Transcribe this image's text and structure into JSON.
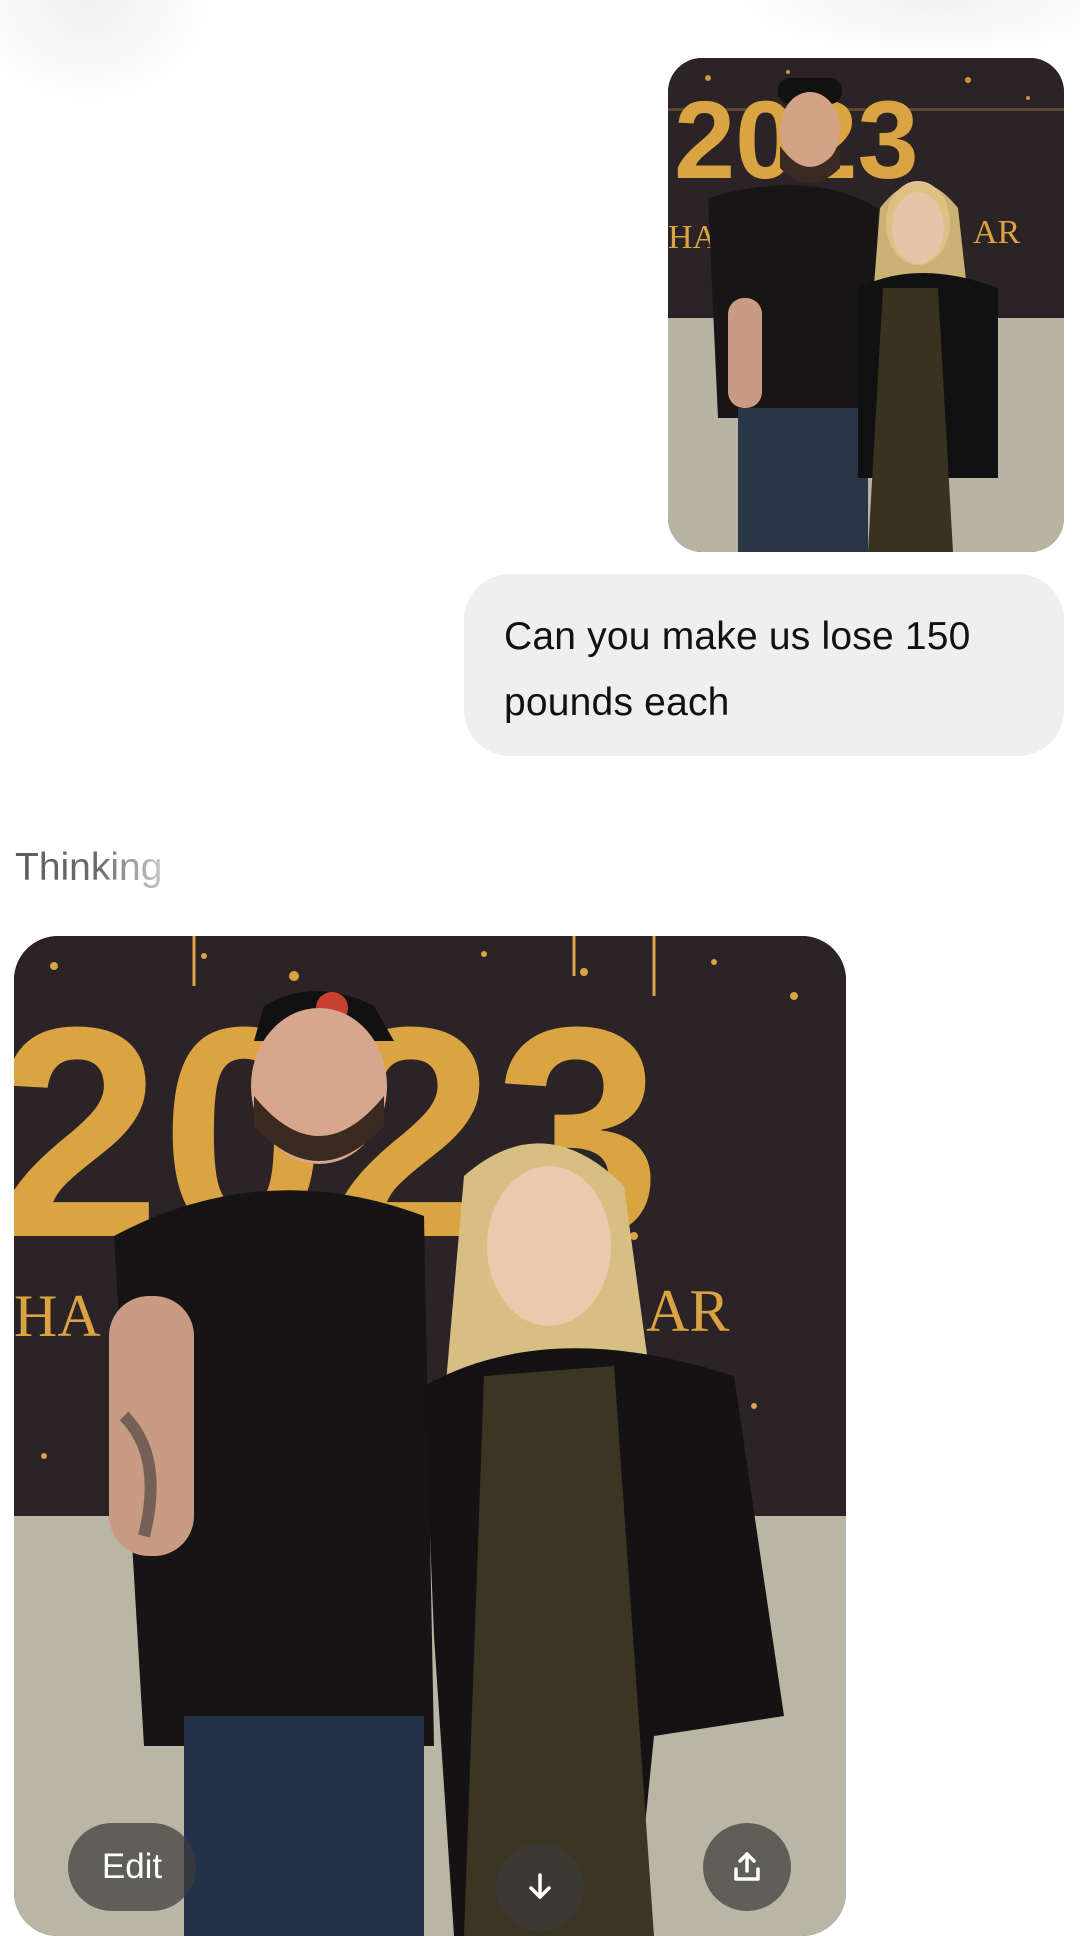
{
  "conversation": {
    "user_message": "Can you make us lose 150 pounds each",
    "status_text": "Thinking"
  },
  "photos": {
    "backdrop_text_year": "2023",
    "backdrop_text_fragment_left": "HA",
    "backdrop_text_fragment_right": "AR"
  },
  "image_actions": {
    "edit_label": "Edit",
    "download_icon": "arrow-down-icon",
    "share_icon": "share-icon"
  },
  "colors": {
    "bubble_bg": "#efeff0",
    "backdrop": "#2b2326",
    "gold": "#d9a441",
    "wall": "#b9b6a6"
  }
}
